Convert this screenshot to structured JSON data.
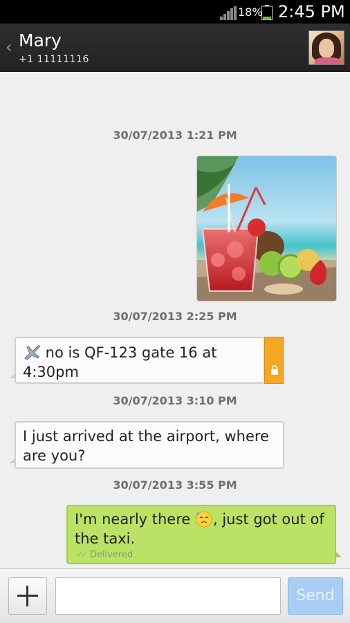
{
  "status_bar": {
    "battery_percent": "18%",
    "time": "2:45 PM",
    "battery_level": 0.18,
    "battery_color": "#7ac943"
  },
  "header": {
    "contact_name": "Mary",
    "contact_number": "+1 11111116"
  },
  "conversation": {
    "timestamps": [
      "30/07/2013 1:21 PM",
      "30/07/2013 2:25 PM",
      "30/07/2013 3:10 PM",
      "30/07/2013 3:55 PM"
    ],
    "messages": [
      {
        "direction": "received",
        "type": "image"
      },
      {
        "direction": "received",
        "text_before_icon": "",
        "text": " no is QF-123  gate 16 at 4:30pm",
        "icon": "airplane-icon",
        "locked": true
      },
      {
        "direction": "received",
        "text": "I just arrived at the airport, where are you?"
      },
      {
        "direction": "sent",
        "text_before_emoji": "I'm nearly there ",
        "emoji": "sweat-face-icon",
        "text_after_emoji": ", just got out of the taxi.",
        "status": "Delivered"
      }
    ]
  },
  "composer": {
    "input_value": "",
    "input_placeholder": "",
    "send_label": "Send"
  },
  "colors": {
    "sent_bubble": "#bbe264",
    "received_bubble": "#fbfbfb",
    "lock_tab": "#f5a623",
    "send_button": "#a9cdf5"
  }
}
